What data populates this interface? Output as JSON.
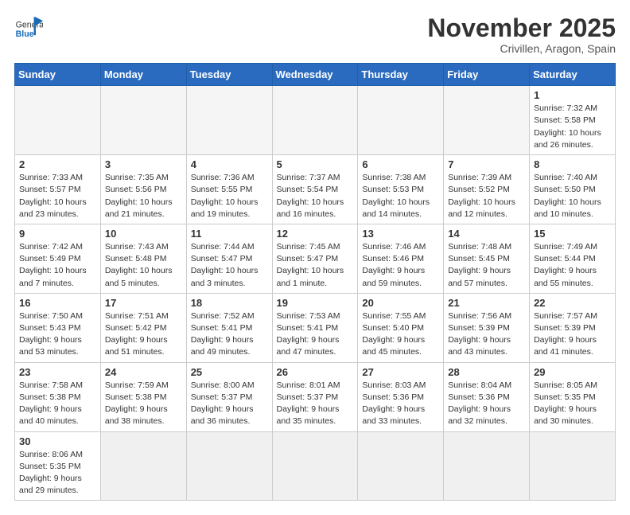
{
  "header": {
    "logo_general": "General",
    "logo_blue": "Blue",
    "month_title": "November 2025",
    "subtitle": "Crivillen, Aragon, Spain"
  },
  "weekdays": [
    "Sunday",
    "Monday",
    "Tuesday",
    "Wednesday",
    "Thursday",
    "Friday",
    "Saturday"
  ],
  "weeks": [
    [
      {
        "day": "",
        "info": ""
      },
      {
        "day": "",
        "info": ""
      },
      {
        "day": "",
        "info": ""
      },
      {
        "day": "",
        "info": ""
      },
      {
        "day": "",
        "info": ""
      },
      {
        "day": "",
        "info": ""
      },
      {
        "day": "1",
        "info": "Sunrise: 7:32 AM\nSunset: 5:58 PM\nDaylight: 10 hours and 26 minutes."
      }
    ],
    [
      {
        "day": "2",
        "info": "Sunrise: 7:33 AM\nSunset: 5:57 PM\nDaylight: 10 hours and 23 minutes."
      },
      {
        "day": "3",
        "info": "Sunrise: 7:35 AM\nSunset: 5:56 PM\nDaylight: 10 hours and 21 minutes."
      },
      {
        "day": "4",
        "info": "Sunrise: 7:36 AM\nSunset: 5:55 PM\nDaylight: 10 hours and 19 minutes."
      },
      {
        "day": "5",
        "info": "Sunrise: 7:37 AM\nSunset: 5:54 PM\nDaylight: 10 hours and 16 minutes."
      },
      {
        "day": "6",
        "info": "Sunrise: 7:38 AM\nSunset: 5:53 PM\nDaylight: 10 hours and 14 minutes."
      },
      {
        "day": "7",
        "info": "Sunrise: 7:39 AM\nSunset: 5:52 PM\nDaylight: 10 hours and 12 minutes."
      },
      {
        "day": "8",
        "info": "Sunrise: 7:40 AM\nSunset: 5:50 PM\nDaylight: 10 hours and 10 minutes."
      }
    ],
    [
      {
        "day": "9",
        "info": "Sunrise: 7:42 AM\nSunset: 5:49 PM\nDaylight: 10 hours and 7 minutes."
      },
      {
        "day": "10",
        "info": "Sunrise: 7:43 AM\nSunset: 5:48 PM\nDaylight: 10 hours and 5 minutes."
      },
      {
        "day": "11",
        "info": "Sunrise: 7:44 AM\nSunset: 5:47 PM\nDaylight: 10 hours and 3 minutes."
      },
      {
        "day": "12",
        "info": "Sunrise: 7:45 AM\nSunset: 5:47 PM\nDaylight: 10 hours and 1 minute."
      },
      {
        "day": "13",
        "info": "Sunrise: 7:46 AM\nSunset: 5:46 PM\nDaylight: 9 hours and 59 minutes."
      },
      {
        "day": "14",
        "info": "Sunrise: 7:48 AM\nSunset: 5:45 PM\nDaylight: 9 hours and 57 minutes."
      },
      {
        "day": "15",
        "info": "Sunrise: 7:49 AM\nSunset: 5:44 PM\nDaylight: 9 hours and 55 minutes."
      }
    ],
    [
      {
        "day": "16",
        "info": "Sunrise: 7:50 AM\nSunset: 5:43 PM\nDaylight: 9 hours and 53 minutes."
      },
      {
        "day": "17",
        "info": "Sunrise: 7:51 AM\nSunset: 5:42 PM\nDaylight: 9 hours and 51 minutes."
      },
      {
        "day": "18",
        "info": "Sunrise: 7:52 AM\nSunset: 5:41 PM\nDaylight: 9 hours and 49 minutes."
      },
      {
        "day": "19",
        "info": "Sunrise: 7:53 AM\nSunset: 5:41 PM\nDaylight: 9 hours and 47 minutes."
      },
      {
        "day": "20",
        "info": "Sunrise: 7:55 AM\nSunset: 5:40 PM\nDaylight: 9 hours and 45 minutes."
      },
      {
        "day": "21",
        "info": "Sunrise: 7:56 AM\nSunset: 5:39 PM\nDaylight: 9 hours and 43 minutes."
      },
      {
        "day": "22",
        "info": "Sunrise: 7:57 AM\nSunset: 5:39 PM\nDaylight: 9 hours and 41 minutes."
      }
    ],
    [
      {
        "day": "23",
        "info": "Sunrise: 7:58 AM\nSunset: 5:38 PM\nDaylight: 9 hours and 40 minutes."
      },
      {
        "day": "24",
        "info": "Sunrise: 7:59 AM\nSunset: 5:38 PM\nDaylight: 9 hours and 38 minutes."
      },
      {
        "day": "25",
        "info": "Sunrise: 8:00 AM\nSunset: 5:37 PM\nDaylight: 9 hours and 36 minutes."
      },
      {
        "day": "26",
        "info": "Sunrise: 8:01 AM\nSunset: 5:37 PM\nDaylight: 9 hours and 35 minutes."
      },
      {
        "day": "27",
        "info": "Sunrise: 8:03 AM\nSunset: 5:36 PM\nDaylight: 9 hours and 33 minutes."
      },
      {
        "day": "28",
        "info": "Sunrise: 8:04 AM\nSunset: 5:36 PM\nDaylight: 9 hours and 32 minutes."
      },
      {
        "day": "29",
        "info": "Sunrise: 8:05 AM\nSunset: 5:35 PM\nDaylight: 9 hours and 30 minutes."
      }
    ],
    [
      {
        "day": "30",
        "info": "Sunrise: 8:06 AM\nSunset: 5:35 PM\nDaylight: 9 hours and 29 minutes."
      },
      {
        "day": "",
        "info": ""
      },
      {
        "day": "",
        "info": ""
      },
      {
        "day": "",
        "info": ""
      },
      {
        "day": "",
        "info": ""
      },
      {
        "day": "",
        "info": ""
      },
      {
        "day": "",
        "info": ""
      }
    ]
  ]
}
